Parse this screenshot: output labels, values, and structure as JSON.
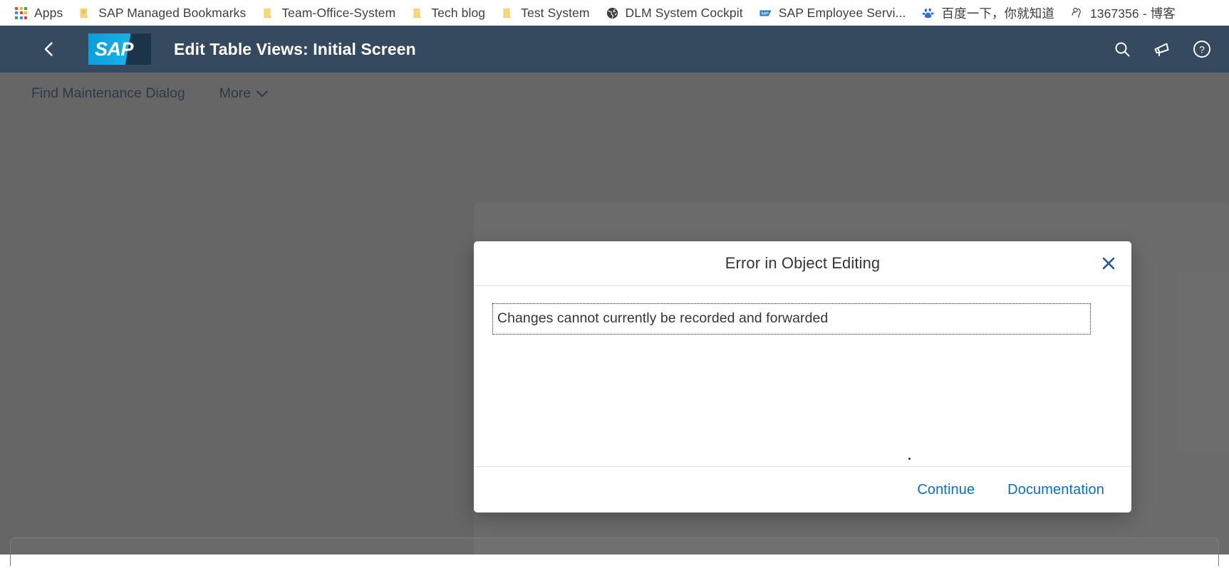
{
  "browser": {
    "bookmarks": [
      {
        "label": "Apps",
        "icon": "apps-grid-icon"
      },
      {
        "label": "SAP Managed Bookmarks",
        "icon": "folder-icon"
      },
      {
        "label": "Team-Office-System",
        "icon": "folder-icon"
      },
      {
        "label": "Tech blog",
        "icon": "folder-icon"
      },
      {
        "label": "Test System",
        "icon": "folder-icon"
      },
      {
        "label": "DLM System Cockpit",
        "icon": "globe-icon"
      },
      {
        "label": "SAP Employee Servi...",
        "icon": "sap-icon"
      },
      {
        "label": "百度一下，你就知道",
        "icon": "baidu-paw-icon"
      },
      {
        "label": "1367356 - 博客",
        "icon": "person-icon"
      }
    ]
  },
  "shell": {
    "back_icon": "back-chevron-icon",
    "logo_text": "SAP",
    "title": "Edit Table Views: Initial Screen",
    "actions": [
      {
        "name": "search-icon",
        "label": "Search"
      },
      {
        "name": "megaphone-icon",
        "label": "Notifications"
      },
      {
        "name": "help-icon",
        "label": "Help"
      }
    ]
  },
  "toolbar": {
    "find_maintenance_dialog_label": "Find Maintenance Dialog",
    "more_label": "More"
  },
  "dialog": {
    "title": "Error in Object Editing",
    "close_icon": "close-icon",
    "message": "Changes cannot currently be recorded and forwarded",
    "buttons": [
      {
        "label": "Continue",
        "name": "continue-button"
      },
      {
        "label": "Documentation",
        "name": "documentation-button"
      }
    ]
  },
  "colors": {
    "shell_bg": "#354a5f",
    "overlay": "#666666",
    "accent_blue": "#0a6ed1",
    "logo_blue": "#17b1e8",
    "text_dark": "#32363a"
  }
}
